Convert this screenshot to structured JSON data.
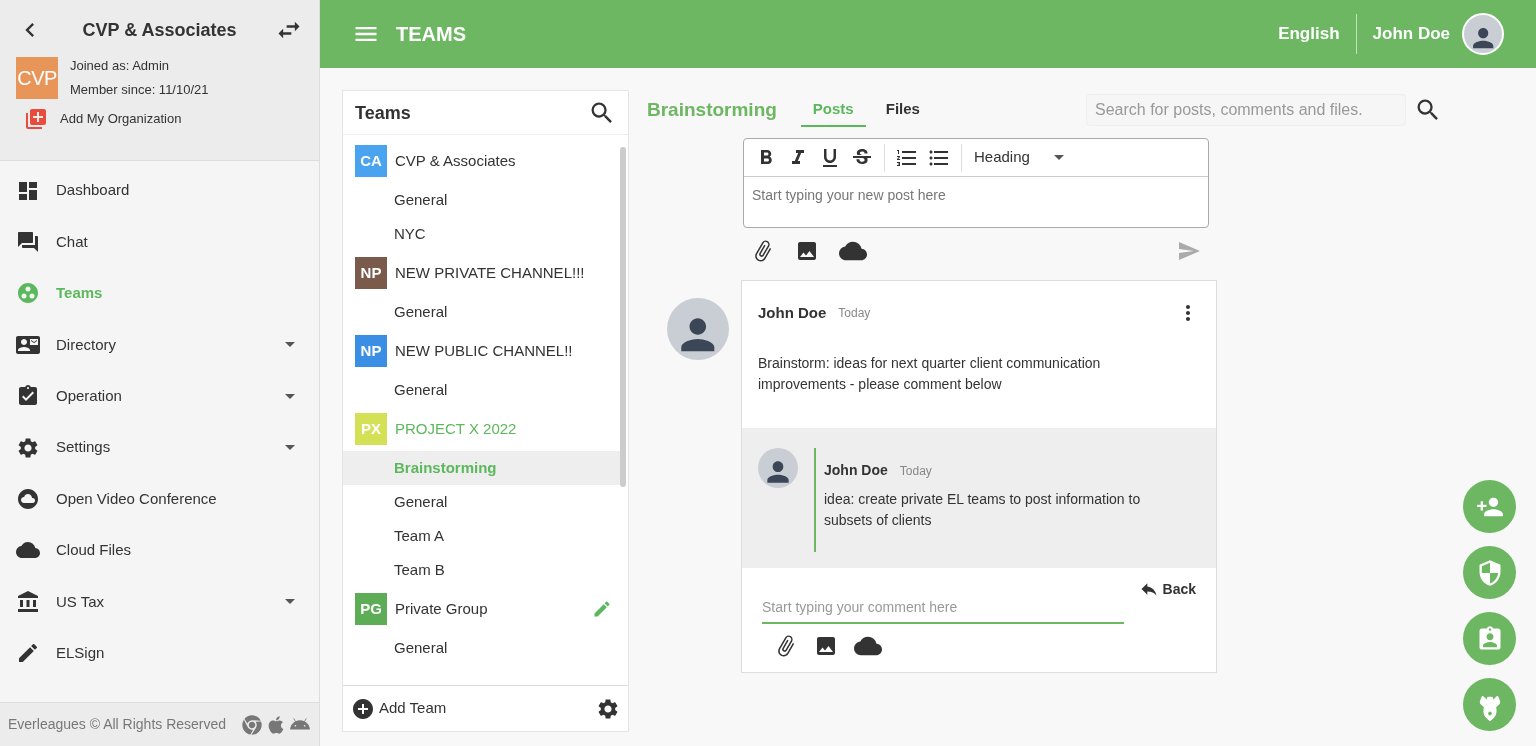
{
  "sidebar": {
    "title": "CVP & Associates",
    "logo_text": "CVP",
    "joined": "Joined as: Admin",
    "member_since": "Member since: 11/10/21",
    "add_org": "Add My Organization",
    "items": [
      {
        "label": "Dashboard",
        "selected": false,
        "expandable": false
      },
      {
        "label": "Chat",
        "selected": false,
        "expandable": false
      },
      {
        "label": "Teams",
        "selected": true,
        "expandable": false
      },
      {
        "label": "Directory",
        "selected": false,
        "expandable": true
      },
      {
        "label": "Operation",
        "selected": false,
        "expandable": true
      },
      {
        "label": "Settings",
        "selected": false,
        "expandable": true
      },
      {
        "label": "Open Video Conference",
        "selected": false,
        "expandable": false
      },
      {
        "label": "Cloud Files",
        "selected": false,
        "expandable": false
      },
      {
        "label": "US Tax",
        "selected": false,
        "expandable": true
      },
      {
        "label": "ELSign",
        "selected": false,
        "expandable": false
      }
    ],
    "footer": "Everleagues © All Rights Reserved"
  },
  "topbar": {
    "title": "TEAMS",
    "language": "English",
    "user": "John Doe"
  },
  "teams_panel": {
    "title": "Teams",
    "add_team": "Add Team",
    "teams": [
      {
        "initials": "CA",
        "color": "#4aa3ee",
        "name": "CVP & Associates",
        "selected": false,
        "editable": false,
        "channels": [
          {
            "name": "General",
            "selected": false
          },
          {
            "name": "NYC",
            "selected": false
          }
        ]
      },
      {
        "initials": "NP",
        "color": "#7a5a4a",
        "name": "NEW PRIVATE CHANNEL!!!",
        "selected": false,
        "editable": false,
        "channels": [
          {
            "name": "General",
            "selected": false
          }
        ]
      },
      {
        "initials": "NP",
        "color": "#3a8fe4",
        "name": "NEW PUBLIC CHANNEL!!",
        "selected": false,
        "editable": false,
        "channels": [
          {
            "name": "General",
            "selected": false
          }
        ]
      },
      {
        "initials": "PX",
        "color": "#d4e157",
        "name": "PROJECT X 2022",
        "selected": true,
        "editable": false,
        "channels": [
          {
            "name": "Brainstorming",
            "selected": true
          },
          {
            "name": "General",
            "selected": false
          },
          {
            "name": "Team A",
            "selected": false
          },
          {
            "name": "Team B",
            "selected": false
          }
        ]
      },
      {
        "initials": "PG",
        "color": "#5cad55",
        "name": "Private Group",
        "selected": false,
        "editable": true,
        "channels": [
          {
            "name": "General",
            "selected": false
          }
        ]
      }
    ]
  },
  "channel": {
    "title": "Brainstorming",
    "tabs": [
      {
        "label": "Posts",
        "selected": true
      },
      {
        "label": "Files",
        "selected": false
      }
    ],
    "search": {
      "placeholder": "Search for posts, comments and files."
    },
    "editor": {
      "heading": "Heading",
      "placeholder": "Start typing your new post here"
    },
    "post": {
      "author": "John Doe",
      "time": "Today",
      "text": "Brainstorm: ideas for next quarter client communication improvements - please comment below",
      "comment": {
        "author": "John Doe",
        "time": "Today",
        "text": "idea: create private EL teams to post information to subsets of clients"
      },
      "reply_placeholder": "Start typing your comment here",
      "back": "Back"
    }
  }
}
